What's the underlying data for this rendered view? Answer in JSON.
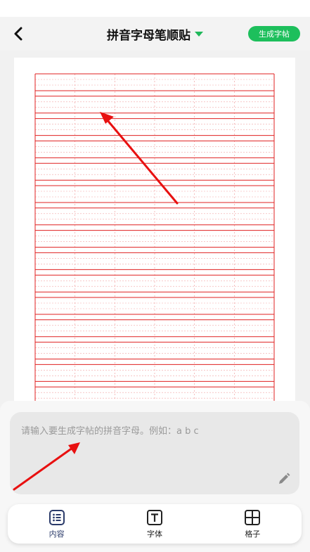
{
  "header": {
    "title": "拼音字母笔顺贴",
    "generate_button": "生成字帖"
  },
  "input": {
    "placeholder": "请输入要生成字帖的拼音字母。例如：a b c",
    "value": ""
  },
  "tabs": [
    {
      "label": "内容",
      "icon": "list-icon",
      "active": true
    },
    {
      "label": "字体",
      "icon": "font-icon",
      "active": false
    },
    {
      "label": "格子",
      "icon": "grid-icon",
      "active": false
    }
  ],
  "colors": {
    "accent_green": "#1dbf5c",
    "grid_red": "#e02020",
    "annotation_arrow": "#e81010",
    "active_tab": "#2b3b6a"
  }
}
